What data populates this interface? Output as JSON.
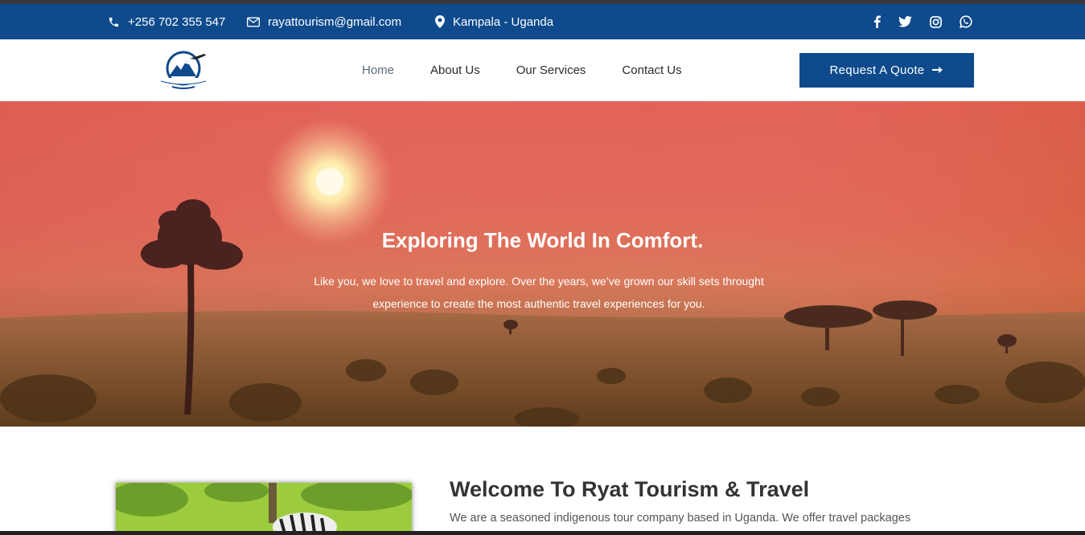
{
  "topbar": {
    "phone": "+256 702 355 547",
    "email": "rayattourism@gmail.com",
    "location": "Kampala - Uganda",
    "social": [
      "facebook-icon",
      "twitter-icon",
      "instagram-icon",
      "whatsapp-icon"
    ]
  },
  "nav": {
    "items": [
      "Home",
      "About Us",
      "Our Services",
      "Contact Us"
    ],
    "active": "Home",
    "cta": "Request A Quote"
  },
  "hero": {
    "title": "Exploring The World In Comfort.",
    "text": "Like you, we love to travel and explore. Over the years, we’ve grown our skill sets throught experience to create the most authentic travel experiences for you."
  },
  "welcome": {
    "title": "Welcome To Ryat Tourism & Travel",
    "text": "We are a seasoned indigenous tour company based in Uganda. We offer travel packages"
  },
  "colors": {
    "brand": "#0e4a8c",
    "white": "#ffffff"
  }
}
